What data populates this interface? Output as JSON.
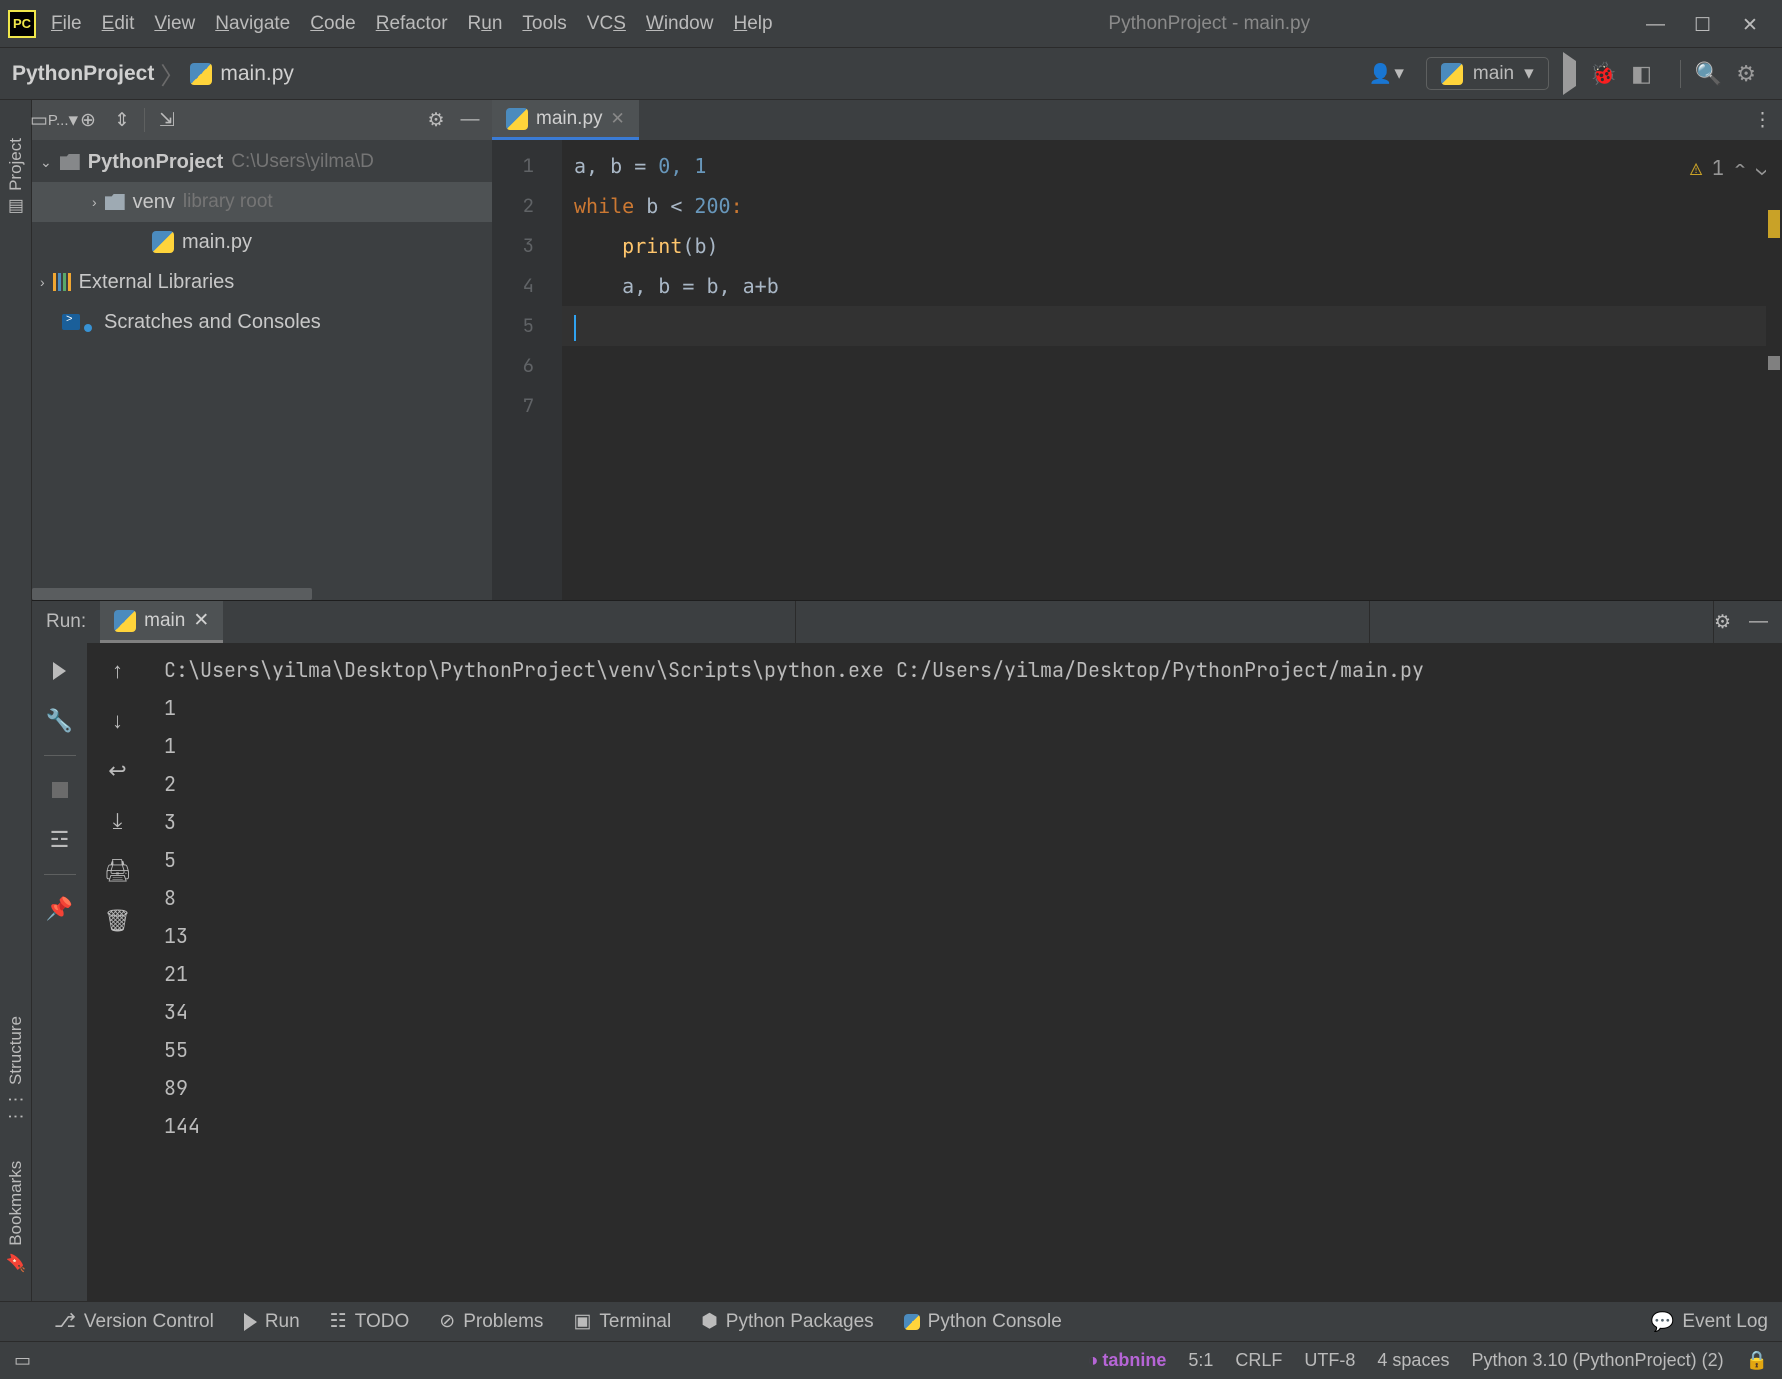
{
  "titlebar": {
    "title": "PythonProject - main.py",
    "menus": [
      "File",
      "Edit",
      "View",
      "Navigate",
      "Code",
      "Refactor",
      "Run",
      "Tools",
      "VCS",
      "Window",
      "Help"
    ]
  },
  "navbar": {
    "breadcrumb_root": "PythonProject",
    "breadcrumb_file": "main.py",
    "run_config": "main"
  },
  "project": {
    "tool_label": "P...",
    "root": "PythonProject",
    "root_path": "C:\\Users\\yilma\\D",
    "venv": "venv",
    "venv_hint": "library root",
    "file": "main.py",
    "ext_lib": "External Libraries",
    "scratches": "Scratches and Consoles"
  },
  "side_tools": {
    "project": "Project",
    "structure": "Structure",
    "bookmarks": "Bookmarks"
  },
  "editor": {
    "tab": "main.py",
    "warning_count": "1",
    "line_numbers": [
      "1",
      "2",
      "3",
      "4",
      "5",
      "6",
      "7"
    ],
    "code_tokens": {
      "l1_a": "a, b ",
      "l1_eq": "=",
      "l1_b": " 0, 1",
      "l2_while": "while",
      "l2_body": " b ",
      "l2_lt": "<",
      "l2_num": " 200",
      "l2_col": ":",
      "l3_indent": "    ",
      "l3_fn": "print",
      "l3_open": "(",
      "l3_arg": "b",
      "l3_close": ")",
      "l4_indent": "    ",
      "l4_body": "a, b ",
      "l4_eq": "=",
      "l4_body2": " b, a",
      "l4_plus": "+",
      "l4_body3": "b"
    }
  },
  "run": {
    "label": "Run:",
    "tab": "main",
    "command": "C:\\Users\\yilma\\Desktop\\PythonProject\\venv\\Scripts\\python.exe C:/Users/yilma/Desktop/PythonProject/main.py",
    "output": [
      "1",
      "1",
      "2",
      "3",
      "5",
      "8",
      "13",
      "21",
      "34",
      "55",
      "89",
      "144"
    ]
  },
  "bottom": {
    "version_control": "Version Control",
    "run": "Run",
    "todo": "TODO",
    "problems": "Problems",
    "terminal": "Terminal",
    "python_packages": "Python Packages",
    "python_console": "Python Console",
    "event_log": "Event Log"
  },
  "status": {
    "tabnine": "tabnine",
    "pos": "5:1",
    "eol": "CRLF",
    "encoding": "UTF-8",
    "indent": "4 spaces",
    "interpreter": "Python 3.10 (PythonProject) (2)"
  }
}
